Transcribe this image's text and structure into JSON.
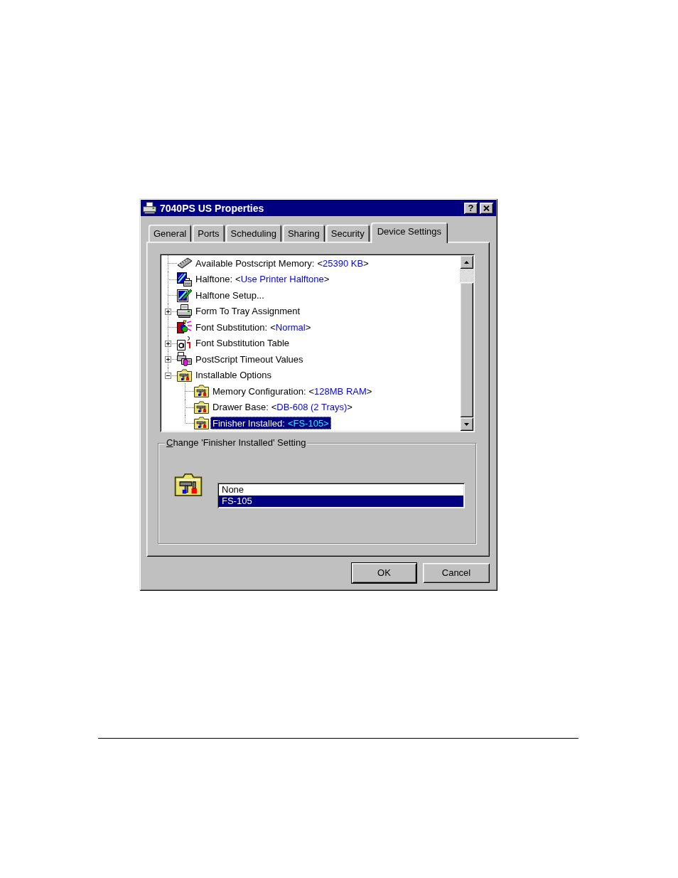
{
  "window": {
    "title": "7040PS US Properties",
    "help_button": "?"
  },
  "tabs": [
    {
      "label": "General",
      "selected": false
    },
    {
      "label": "Ports",
      "selected": false
    },
    {
      "label": "Scheduling",
      "selected": false
    },
    {
      "label": "Sharing",
      "selected": false
    },
    {
      "label": "Security",
      "selected": false
    },
    {
      "label": "Device Settings",
      "selected": true
    }
  ],
  "tree": {
    "items": [
      {
        "label": "Available Postscript Memory:",
        "value": "<25390 KB>",
        "selected": false
      },
      {
        "label": "Halftone:",
        "value": "<Use Printer Halftone>",
        "selected": false
      },
      {
        "label": "Halftone Setup...",
        "selected": false
      },
      {
        "label": "Form To Tray Assignment",
        "expanded": false,
        "selected": false
      },
      {
        "label": "Font Substitution:",
        "value": "<Normal>",
        "selected": false
      },
      {
        "label": "Font Substitution Table",
        "expanded": false,
        "selected": false
      },
      {
        "label": "PostScript Timeout Values",
        "expanded": false,
        "selected": false
      },
      {
        "label": "Installable Options",
        "expanded": true,
        "selected": false,
        "children": [
          {
            "label": "Memory Configuration:",
            "value": "<128MB RAM>",
            "selected": false
          },
          {
            "label": "Drawer Base:",
            "value": "<DB-608 (2 Trays)>",
            "selected": false
          },
          {
            "label": "Finisher Installed:",
            "value": "<FS-105>",
            "selected": true
          }
        ]
      }
    ]
  },
  "setting_group": {
    "title": "Change 'Finisher Installed' Setting",
    "options": [
      {
        "label": "None",
        "selected": false
      },
      {
        "label": "FS-105",
        "selected": true
      }
    ]
  },
  "buttons": [
    {
      "label": "OK",
      "default": true
    },
    {
      "label": "Cancel",
      "default": false
    }
  ]
}
